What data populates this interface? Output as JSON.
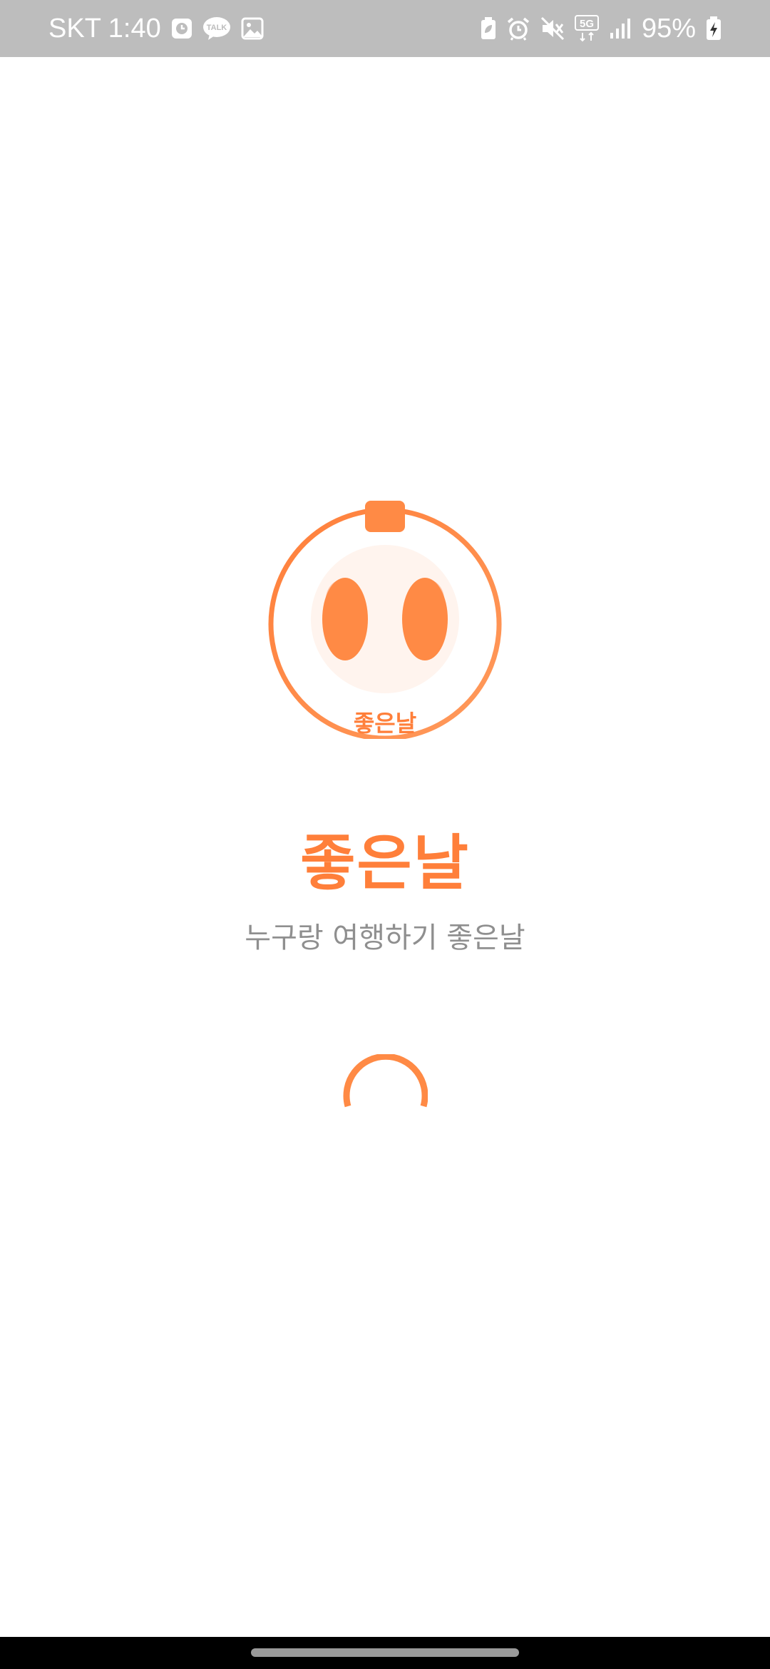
{
  "status_bar": {
    "carrier_time": "SKT 1:40",
    "kakao_label": "TALK",
    "network_label": "5G",
    "battery_percent": "95%"
  },
  "splash": {
    "logo_caption": "좋은날",
    "title": "좋은날",
    "subtitle": "누구랑 여행하기 좋은날"
  },
  "colors": {
    "accent": "#ff7f3a",
    "status_bar_bg": "#bdbdbd",
    "subtitle_text": "#8f8f8f"
  },
  "icons": [
    "clock-app-icon",
    "kakaotalk-icon",
    "gallery-icon",
    "battery-saver-icon",
    "alarm-icon",
    "mute-icon",
    "network-5g-icon",
    "signal-icon",
    "battery-charging-icon"
  ]
}
